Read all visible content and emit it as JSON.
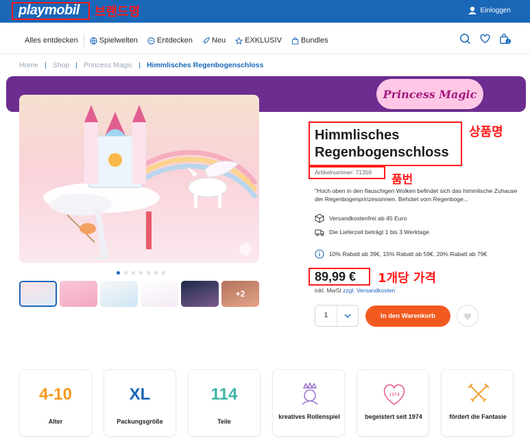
{
  "header": {
    "logo": "playmobil",
    "login_label": "Einloggen"
  },
  "annotations": {
    "brand": "브랜드명",
    "product_name": "상품명",
    "article_no": "품번",
    "unit_price": "1개당 가격"
  },
  "nav": {
    "items": [
      {
        "label": "Alles entdecken",
        "icon": "none"
      },
      {
        "label": "Spielwelten",
        "icon": "globe-icon"
      },
      {
        "label": "Entdecken",
        "icon": "chat-icon"
      },
      {
        "label": "Neu",
        "icon": "rocket-icon"
      },
      {
        "label": "EXKLUSIV",
        "icon": "star-icon"
      },
      {
        "label": "Bundles",
        "icon": "bag-icon"
      }
    ],
    "cart_count": "1"
  },
  "breadcrumb": {
    "items": [
      "Home",
      "Shop",
      "Princess Magic"
    ],
    "current": "Himmlisches Regenbogenschloss"
  },
  "banner": {
    "logo_text": "Princess Magic"
  },
  "gallery": {
    "dot_count": 7,
    "active_dot": 0,
    "more_label": "+2"
  },
  "product": {
    "title": "Himmlisches Regenbogenschloss",
    "article_number": "Artikelnummer: 71359",
    "description": "\"Hoch oben in den flauschigen Wolken befindet sich das himmlische Zuhause der Regenbogenprinzessinnen. Behütet vom Regenboge...",
    "shipping": "Versandkostenfrei ab 45 Euro",
    "delivery": "Die Lieferzeit beträgt 1 bis 3 Werktage",
    "discount": "10% Rabatt ab 39€, 15% Rabatt ab 59€, 20% Rabatt ab 79€",
    "price": "89,99 €",
    "tax_prefix": "inkl. MwSt",
    "tax_link": "zzgl. Versandkosten",
    "quantity": "1",
    "add_to_cart": "In den Warenkorb"
  },
  "features": [
    {
      "value": "4-10",
      "label": "Alter",
      "color": "#f59a1a"
    },
    {
      "value": "XL",
      "label": "Packungsgröße",
      "color": "#1a67b8"
    },
    {
      "value": "114",
      "label": "Teile",
      "color": "#3fb3a5"
    },
    {
      "label": "kreatives Rollenspiel",
      "icon": "princess-icon"
    },
    {
      "label": "begeistert seit 1974",
      "icon": "heart-1974-icon"
    },
    {
      "label": "fördert die Fantasie",
      "icon": "swords-icon"
    }
  ],
  "colors": {
    "brand_blue": "#1a67b8",
    "cta_orange": "#f15a1f",
    "banner_purple": "#6b2d8f",
    "annotation_red": "#ff1a1a"
  }
}
